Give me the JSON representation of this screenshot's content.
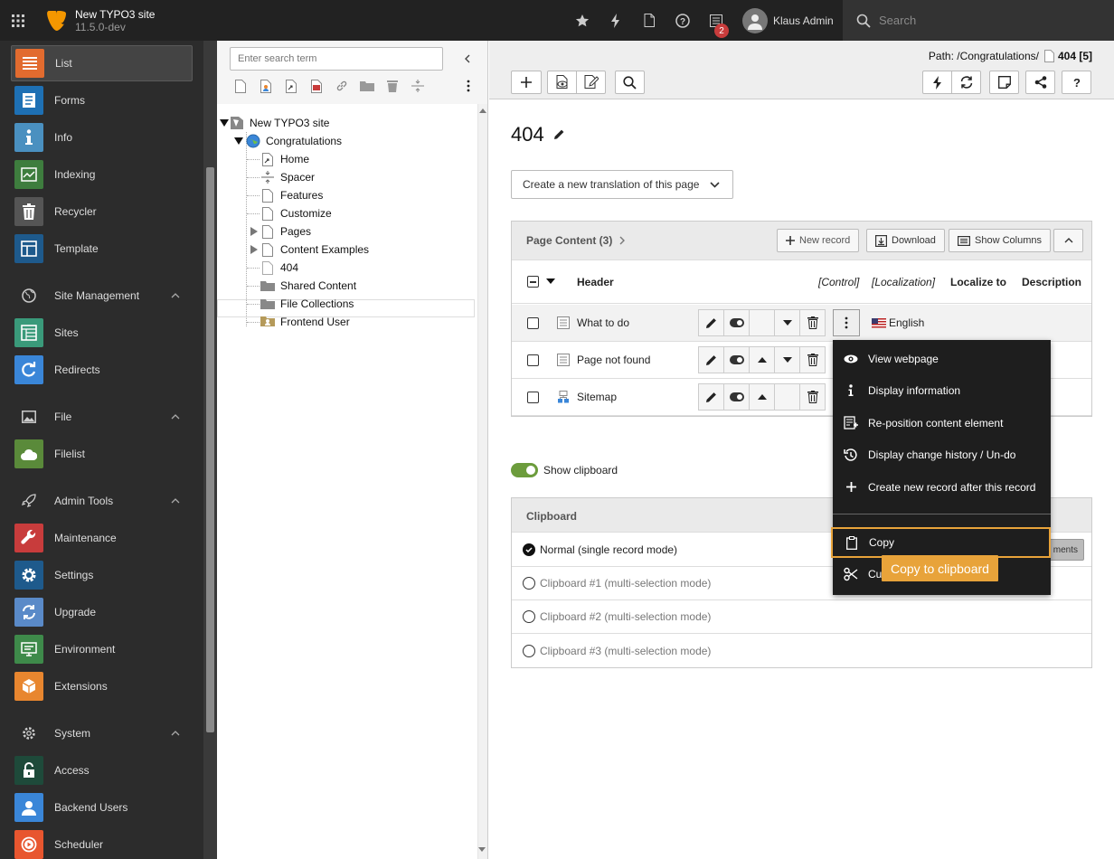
{
  "topbar": {
    "site_name": "New TYPO3 site",
    "site_version": "11.5.0-dev",
    "icons": [
      "bookmark-star-icon",
      "flash-icon",
      "new-page-icon",
      "help-icon",
      "open-docs-icon"
    ],
    "badge_count": "2",
    "user_name": "Klaus Admin",
    "search_placeholder": "Search"
  },
  "sidebar": {
    "items": [
      {
        "label": "List",
        "color": "#e26b2f"
      },
      {
        "label": "Forms",
        "color": "#1e70b4"
      },
      {
        "label": "Info",
        "color": "#4a90c0"
      },
      {
        "label": "Indexing",
        "color": "#3e7d3e"
      },
      {
        "label": "Recycler",
        "color": "#555555"
      },
      {
        "label": "Template",
        "color": "#1e5a8c"
      }
    ],
    "site_management": {
      "label": "Site Management",
      "items": [
        {
          "label": "Sites",
          "color": "#3a9a7a"
        },
        {
          "label": "Redirects",
          "color": "#3a86d8"
        }
      ]
    },
    "file": {
      "label": "File",
      "items": [
        {
          "label": "Filelist",
          "color": "#5a8a3a"
        }
      ]
    },
    "admin_tools": {
      "label": "Admin Tools",
      "items": [
        {
          "label": "Maintenance",
          "color": "#c83c3c"
        },
        {
          "label": "Settings",
          "color": "#1e5a8c"
        },
        {
          "label": "Upgrade",
          "color": "#5a8ac8"
        },
        {
          "label": "Environment",
          "color": "#3e8a4a"
        },
        {
          "label": "Extensions",
          "color": "#e8862f"
        }
      ]
    },
    "system": {
      "label": "System",
      "items": [
        {
          "label": "Access",
          "color": "#1e4a3a"
        },
        {
          "label": "Backend Users",
          "color": "#3a86d8"
        },
        {
          "label": "Scheduler",
          "color": "#e8562f"
        }
      ]
    }
  },
  "tree": {
    "search_placeholder": "Enter search term",
    "nodes": [
      "New TYPO3 site",
      "Congratulations",
      "Home",
      "Spacer",
      "Features",
      "Customize",
      "Pages",
      "Content Examples",
      "404",
      "Shared Content",
      "File Collections",
      "Frontend User"
    ]
  },
  "docheader": {
    "path_label": "Path: /Congratulations/",
    "path_page": "404 [5]"
  },
  "page": {
    "title": "404",
    "translation_select": "Create a new translation of this page"
  },
  "content_panel": {
    "title": "Page Content (3)",
    "btn_new_record": "New record",
    "btn_download": "Download",
    "btn_show_columns": "Show Columns",
    "columns": {
      "header": "Header",
      "control": "[Control]",
      "localization": "[Localization]",
      "localize_to": "Localize to",
      "description": "Description"
    },
    "rows": [
      {
        "label": "What to do",
        "lang": "English"
      },
      {
        "label": "Page not found"
      },
      {
        "label": "Sitemap"
      }
    ]
  },
  "clipboard": {
    "toggle_label": "Show clipboard",
    "title": "Clipboard",
    "modes": [
      "Normal (single record mode)",
      "Clipboard #1 (multi-selection mode)",
      "Clipboard #2 (multi-selection mode)",
      "Clipboard #3 (multi-selection mode)"
    ],
    "elements_btn": "ments"
  },
  "context_menu": {
    "items": [
      "View webpage",
      "Display information",
      "Re-position content element",
      "Display change history / Un-do",
      "Create new record after this record"
    ],
    "copy": "Copy",
    "cut": "Cut"
  },
  "tooltip": "Copy to clipboard",
  "colors": {
    "accent": "#e8a33a",
    "topbar": "#222222",
    "sidebar": "#2c2c2c",
    "toggle_on": "#6c9c3c"
  }
}
